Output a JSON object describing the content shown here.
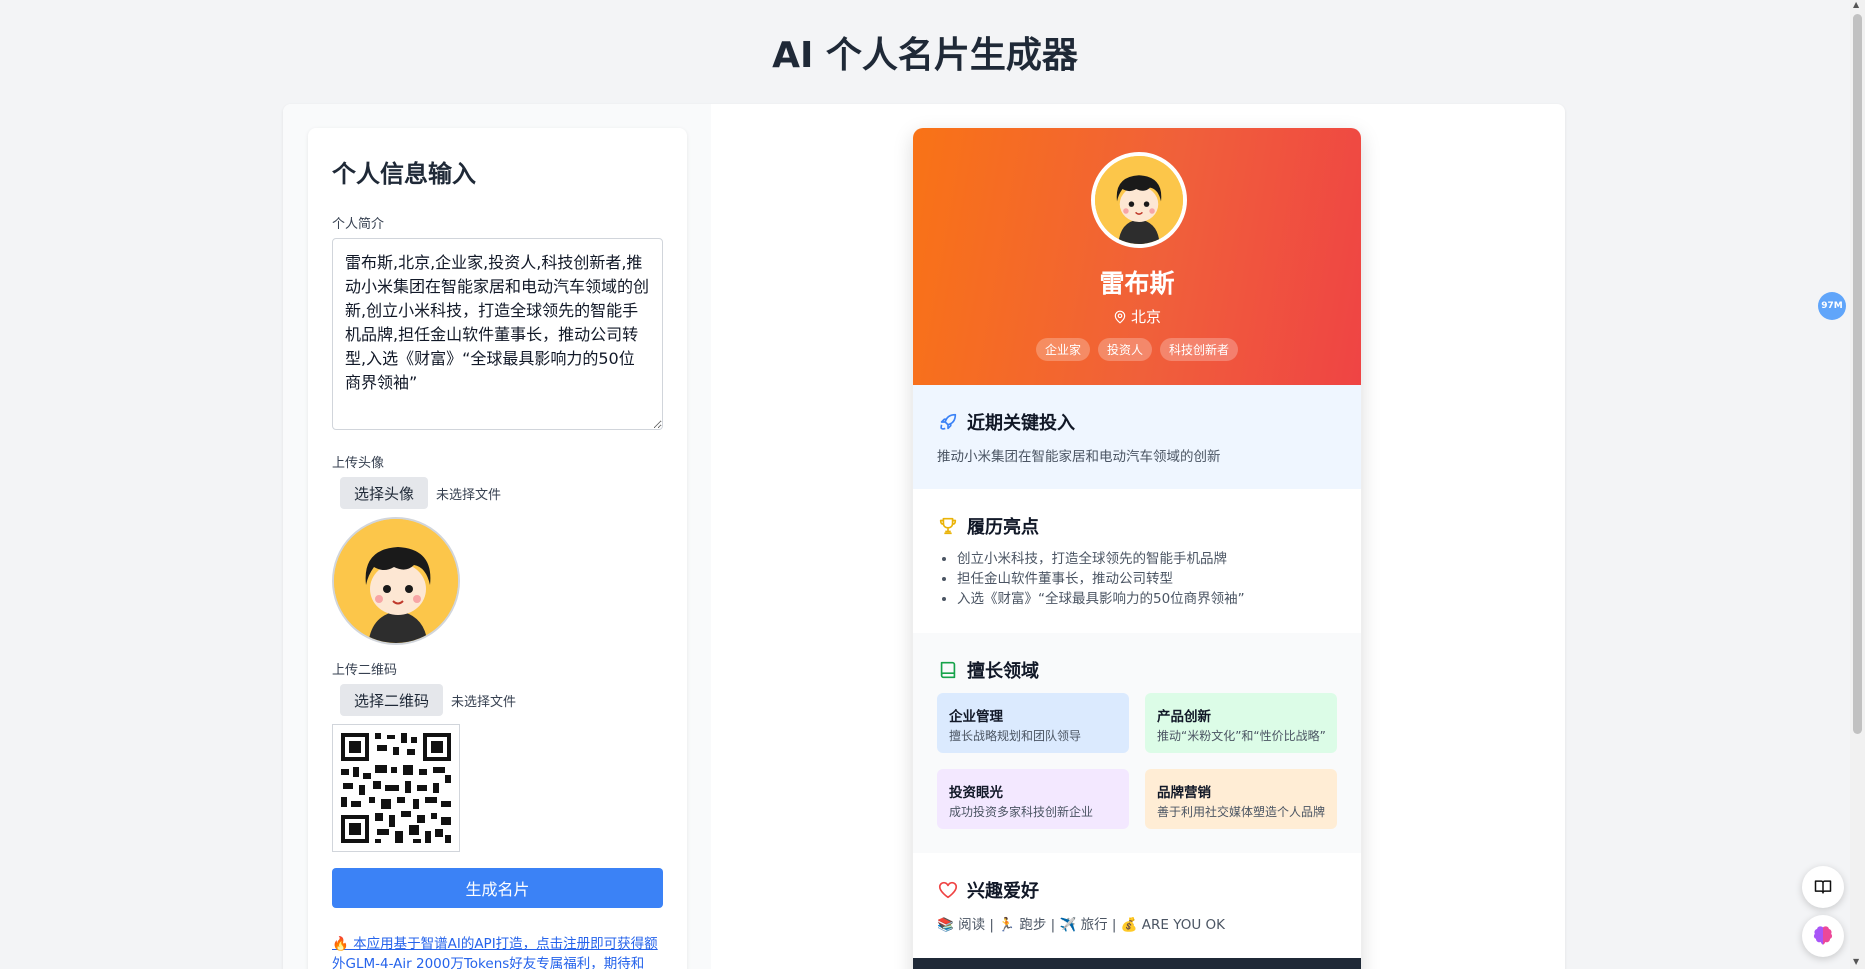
{
  "page": {
    "title": "AI 个人名片生成器"
  },
  "form": {
    "title": "个人信息输入",
    "bio_label": "个人简介",
    "bio_value": "雷布斯,北京,企业家,投资人,科技创新者,推动小米集团在智能家居和电动汽车领域的创新,创立小米科技，打造全球领先的智能手机品牌,担任金山软件董事长，推动公司转型,入选《财富》“全球最具影响力的50位商界领袖”",
    "avatar_label": "上传头像",
    "avatar_button": "选择头像",
    "avatar_status": "未选择文件",
    "qr_label": "上传二维码",
    "qr_button": "选择二维码",
    "qr_status": "未选择文件",
    "generate_button": "生成名片",
    "api_note": "🔥 本应用基于智谱AI的API打造，点击注册即可获得额外GLM-4-Air 2000万Tokens好友专属福利，期待和"
  },
  "card": {
    "name": "雷布斯",
    "location": "北京",
    "tags": [
      "企业家",
      "投资人",
      "科技创新者"
    ],
    "recent": {
      "title": "近期关键投入",
      "text": "推动小米集团在智能家居和电动汽车领域的创新"
    },
    "highlights": {
      "title": "履历亮点",
      "items": [
        "创立小米科技，打造全球领先的智能手机品牌",
        "担任金山软件董事长，推动公司转型",
        "入选《财富》“全球最具影响力的50位商界领袖”"
      ]
    },
    "expertise": {
      "title": "擅长领域",
      "items": [
        {
          "title": "企业管理",
          "desc": "擅长战略规划和团队领导",
          "color": "#dbeafe"
        },
        {
          "title": "产品创新",
          "desc": "推动“米粉文化”和“性价比战略”",
          "color": "#dcfce7"
        },
        {
          "title": "投资眼光",
          "desc": "成功投资多家科技创新企业",
          "color": "#f3e8ff"
        },
        {
          "title": "品牌营销",
          "desc": "善于利用社交媒体塑造个人品牌",
          "color": "#ffedd5"
        }
      ]
    },
    "hobbies": {
      "title": "兴趣爱好",
      "text": "📚 阅读 | 🏃 跑步 | ✈️ 旅行 | 💰 ARE YOU OK"
    }
  },
  "widgets": {
    "memory_badge": "97M"
  },
  "colors": {
    "accent": "#3b82f6",
    "header_start": "#f97316",
    "header_end": "#ef4444"
  }
}
